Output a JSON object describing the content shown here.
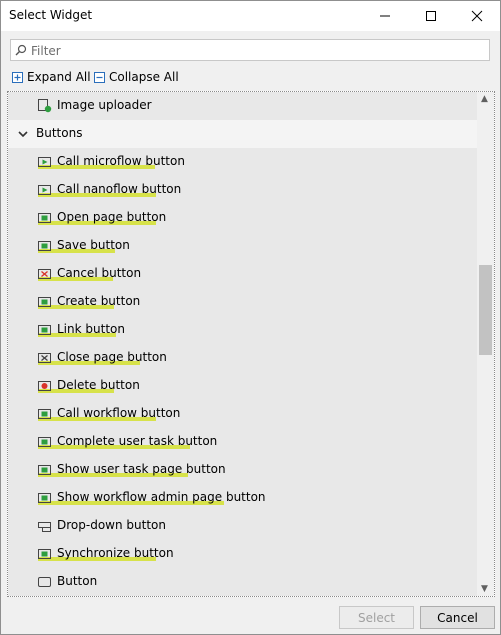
{
  "window": {
    "title": "Select Widget"
  },
  "filter": {
    "placeholder": "Filter"
  },
  "toolbar": {
    "expand_all": "Expand All",
    "collapse_all": "Collapse All"
  },
  "tree": {
    "items": [
      {
        "label": "Image uploader",
        "icon": "image-uploader-icon",
        "highlight": false
      },
      {
        "label": "Buttons",
        "icon": "chevron-down-icon",
        "group": true
      },
      {
        "label": "Call microflow button",
        "icon": "call-microflow-icon",
        "highlight": true
      },
      {
        "label": "Call nanoflow button",
        "icon": "call-nanoflow-icon",
        "highlight": true
      },
      {
        "label": "Open page button",
        "icon": "open-page-icon",
        "highlight": true
      },
      {
        "label": "Save button",
        "icon": "save-icon",
        "highlight": true
      },
      {
        "label": "Cancel button",
        "icon": "cancel-icon",
        "highlight": true
      },
      {
        "label": "Create button",
        "icon": "create-icon",
        "highlight": true
      },
      {
        "label": "Link button",
        "icon": "link-icon",
        "highlight": true
      },
      {
        "label": "Close page button",
        "icon": "close-page-icon",
        "highlight": true
      },
      {
        "label": "Delete button",
        "icon": "delete-icon",
        "highlight": true
      },
      {
        "label": "Call workflow button",
        "icon": "workflow-icon",
        "highlight": true
      },
      {
        "label": "Complete user task button",
        "icon": "user-task-icon",
        "highlight": true
      },
      {
        "label": "Show user task page button",
        "icon": "user-task-page-icon",
        "highlight": true
      },
      {
        "label": "Show workflow admin page button",
        "icon": "workflow-admin-icon",
        "highlight": true
      },
      {
        "label": "Drop-down button",
        "icon": "dropdown-button-icon",
        "highlight": false
      },
      {
        "label": "Synchronize button",
        "icon": "synchronize-icon",
        "highlight": true
      },
      {
        "label": "Button",
        "icon": "button-icon",
        "highlight": false
      }
    ]
  },
  "buttons": {
    "select": "Select",
    "cancel": "Cancel"
  },
  "colors": {
    "highlight": "#d7e24a",
    "icon_green": "#2e9e3f",
    "icon_red": "#d9332b"
  }
}
